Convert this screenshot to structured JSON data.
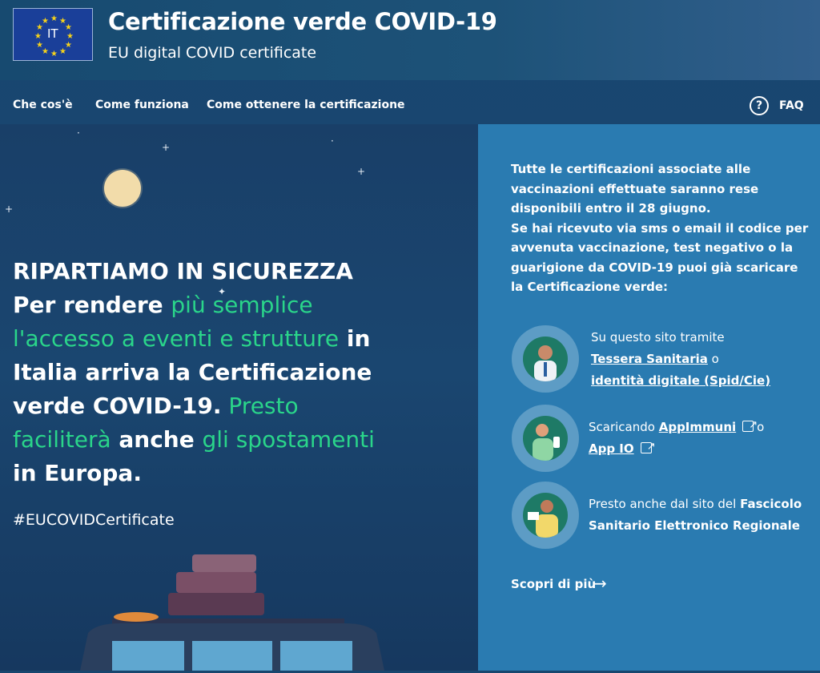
{
  "header": {
    "flag_label": "IT",
    "title": "Certificazione verde COVID-19",
    "subtitle": "EU digital COVID certificate"
  },
  "nav": {
    "items": [
      "Che cos'è",
      "Come funziona",
      "Come ottenere la certificazione"
    ],
    "faq": "FAQ"
  },
  "hero": {
    "headline": "RIPARTIAMO IN SICUREZZA",
    "l1a": "Per rendere ",
    "l1b": "più semplice",
    "l2a": "l'accesso a eventi e strutture",
    "l2b": " in",
    "l3": "Italia arriva la Certificazione",
    "l4a": "verde COVID-19.",
    "l4b": " Presto",
    "l5a": "faciliterà",
    "l5b": " anche ",
    "l5c": "gli spostamenti",
    "l6": "in Europa.",
    "hashtag": "#EUCOVIDCertificate"
  },
  "panel": {
    "intro": "Tutte le certificazioni associate alle vaccinazioni effettuate saranno rese disponibili entro il 28 giugno.",
    "intro2": "Se hai ricevuto via sms o email il codice per avvenuta vaccinazione, test negativo o la guarigione da COVID-19 puoi già scaricare la Certificazione verde:",
    "item1": {
      "pre": "Su questo sito tramite",
      "link1": "Tessera Sanitaria",
      "mid": " o",
      "link2": "identità digitale (Spid/Cie)"
    },
    "item2": {
      "pre": "Scaricando ",
      "link1": "AppImmuni",
      "mid": "o",
      "link2": "App IO"
    },
    "item3": {
      "pre": "Presto anche dal sito del ",
      "bold1": "Fascicolo",
      "bold2": "Sanitario Elettronico Regionale"
    },
    "more": "Scopri di più"
  },
  "colors": {
    "accent_green": "#2ad58a",
    "panel_blue": "#2a7bb1",
    "bg_navy": "#18466e"
  }
}
